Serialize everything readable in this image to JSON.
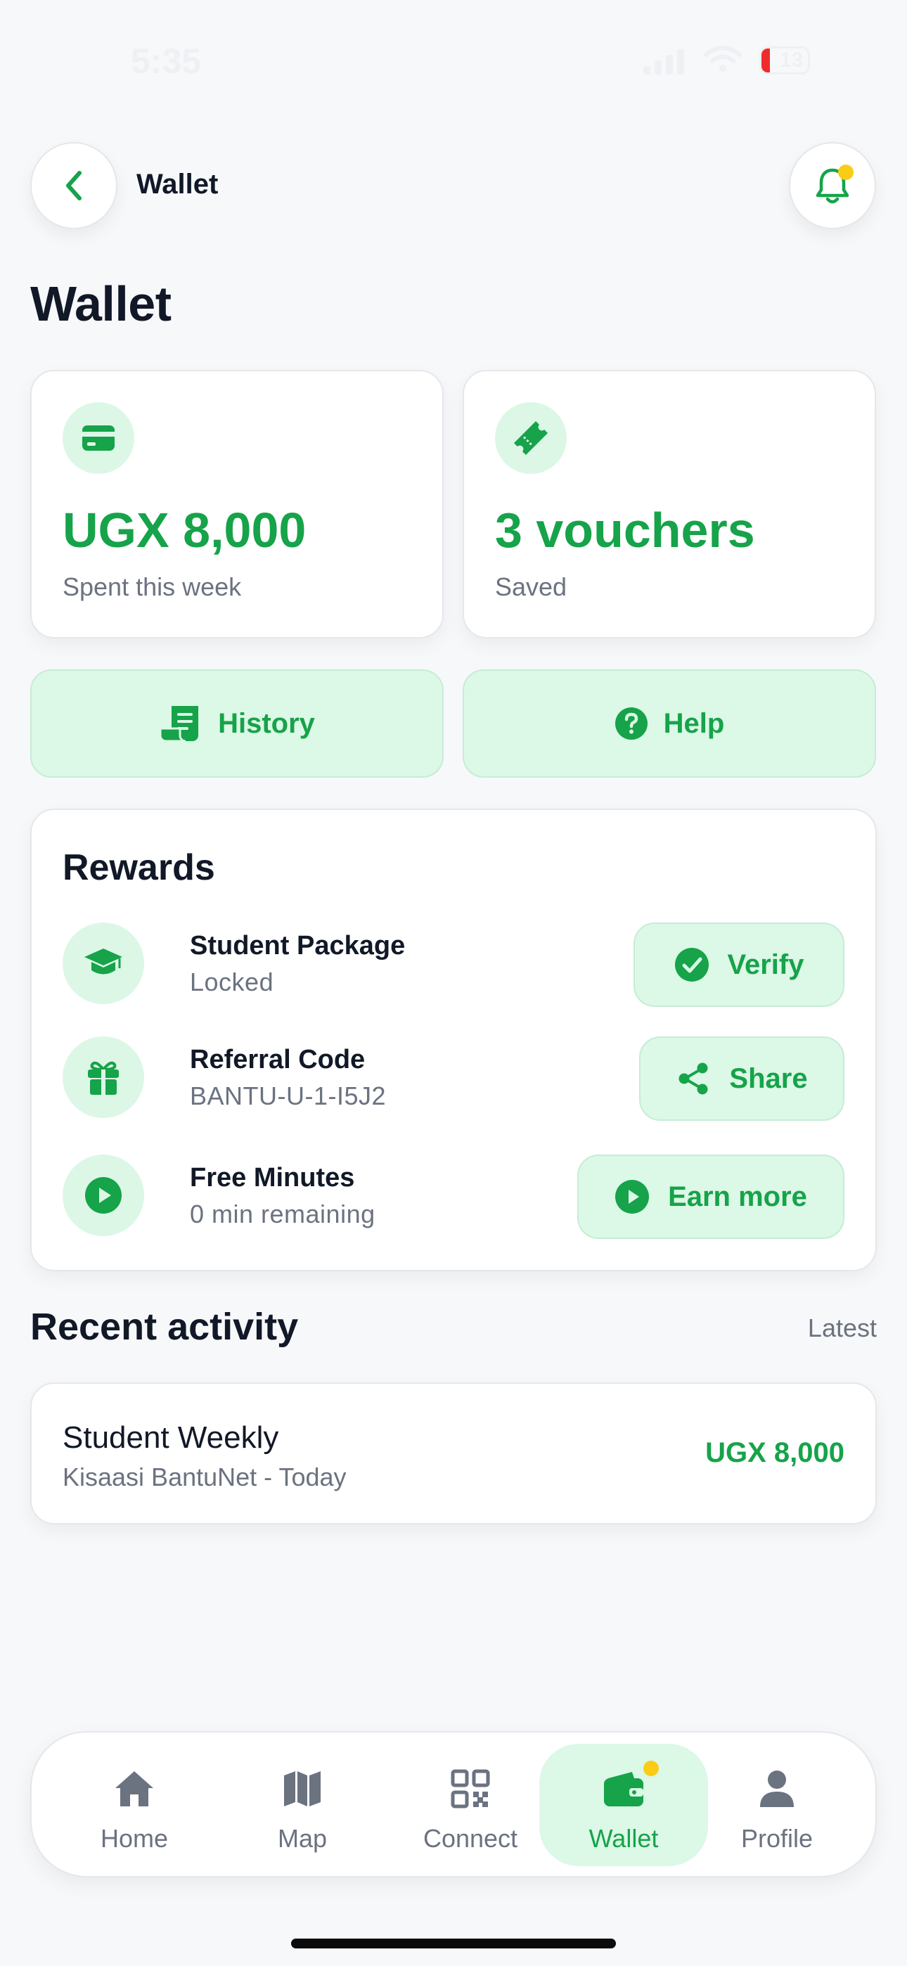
{
  "status_bar": {
    "time": "5:35",
    "battery": "13"
  },
  "header": {
    "title": "Wallet"
  },
  "page": {
    "title": "Wallet"
  },
  "stats": [
    {
      "value": "UGX 8,000",
      "label": "Spent this week",
      "icon": "card-icon"
    },
    {
      "value": "3 vouchers",
      "label": "Saved",
      "icon": "ticket-icon"
    }
  ],
  "actions": {
    "history_label": "History",
    "help_label": "Help"
  },
  "rewards": {
    "title": "Rewards",
    "items": [
      {
        "title": "Student Package",
        "subtitle": "Locked",
        "button": "Verify",
        "icon": "graduation-cap-icon"
      },
      {
        "title": "Referral Code",
        "subtitle": "BANTU-U-1-I5J2",
        "button": "Share",
        "icon": "gift-icon"
      },
      {
        "title": "Free Minutes",
        "subtitle": "0 min remaining",
        "button": "Earn more",
        "icon": "play-icon"
      }
    ]
  },
  "recent": {
    "title": "Recent activity",
    "link": "Latest",
    "items": [
      {
        "title": "Student Weekly",
        "subtitle": "Kisaasi BantuNet - Today",
        "amount": "UGX 8,000"
      }
    ]
  },
  "nav": {
    "items": [
      {
        "label": "Home",
        "icon": "home-icon"
      },
      {
        "label": "Map",
        "icon": "map-icon"
      },
      {
        "label": "Connect",
        "icon": "qr-icon"
      },
      {
        "label": "Wallet",
        "icon": "wallet-icon",
        "active": true
      },
      {
        "label": "Profile",
        "icon": "profile-icon"
      }
    ]
  },
  "colors": {
    "accent": "#16a34a",
    "accent_soft": "#dcf8e6",
    "badge": "#facc15"
  }
}
